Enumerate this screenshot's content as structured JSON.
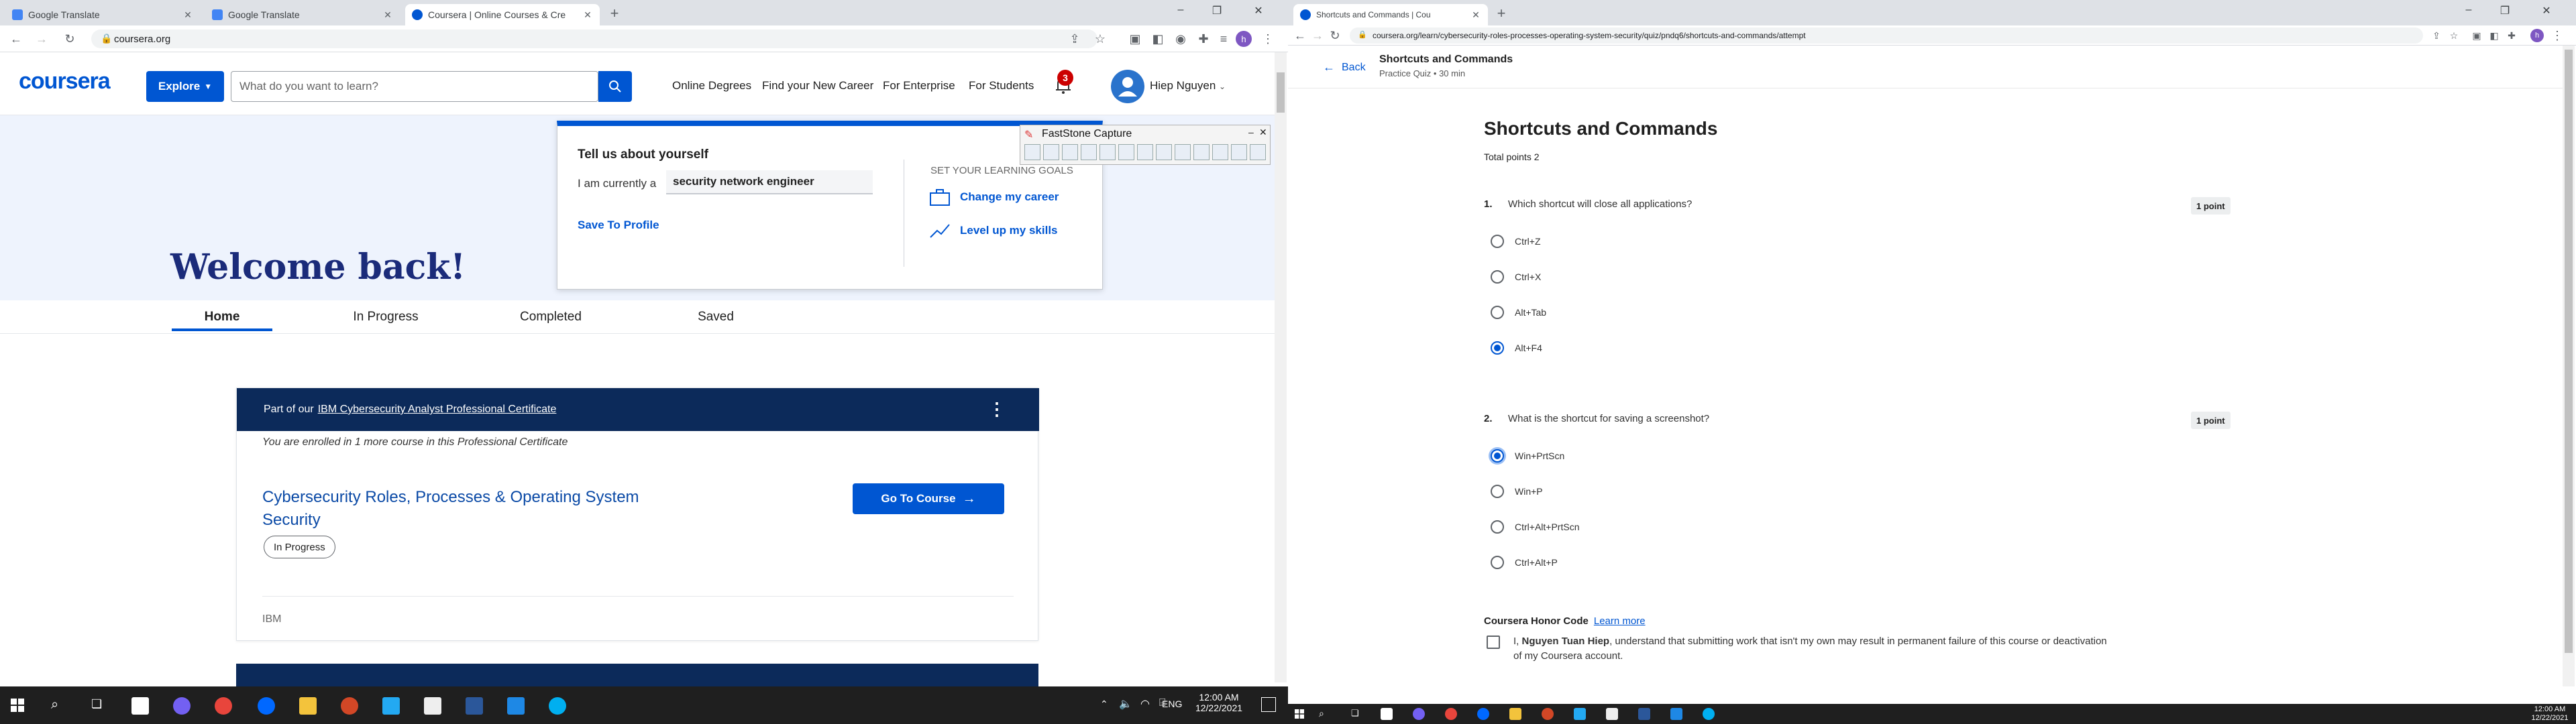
{
  "left": {
    "tabs": [
      {
        "title": "Google Translate",
        "active": false
      },
      {
        "title": "Google Translate",
        "active": false
      },
      {
        "title": "Coursera | Online Courses & Cre",
        "active": true
      }
    ],
    "url": "coursera.org",
    "profile_letter": "h",
    "header": {
      "logo": "coursera",
      "explore": "Explore",
      "search_placeholder": "What do you want to learn?",
      "links": [
        "Online Degrees",
        "Find your New Career",
        "For Enterprise",
        "For Students"
      ],
      "notif_count": "3",
      "user_name": "Hiep Nguyen"
    },
    "popup": {
      "heading": "Tell us about yourself",
      "currently_label": "I am currently a",
      "currently_value": "security network engineer",
      "save_link": "Save To Profile",
      "goals_heading": "SET YOUR LEARNING GOALS",
      "goals": [
        "Change my career",
        "Level up my skills"
      ]
    },
    "faststone": {
      "title": "FastStone Capture"
    },
    "welcome": "Welcome back!",
    "subtabs": [
      "Home",
      "In Progress",
      "Completed",
      "Saved"
    ],
    "card": {
      "part_of": "Part of our",
      "cert_link": "IBM Cybersecurity Analyst Professional Certificate",
      "enrolled": "You are enrolled in 1 more course in this Professional Certificate",
      "course_title": "Cybersecurity Roles, Processes & Operating System Security",
      "status": "In Progress",
      "go_button": "Go To Course",
      "provider": "IBM"
    },
    "taskbar": {
      "lang": "ENG",
      "time": "12:00 AM",
      "date": "12/22/2021"
    }
  },
  "right": {
    "tab_title": "Shortcuts and Commands | Cou",
    "url": "coursera.org/learn/cybersecurity-roles-processes-operating-system-security/quiz/pndq6/shortcuts-and-commands/attempt",
    "profile_letter": "h",
    "header": {
      "back": "Back",
      "title": "Shortcuts and Commands",
      "subtitle": "Practice Quiz • 30 min"
    },
    "quiz": {
      "title": "Shortcuts and Commands",
      "total_points": "Total points 2",
      "questions": [
        {
          "num": "1.",
          "text": "Which shortcut will close all applications?",
          "points": "1 point",
          "options": [
            "Ctrl+Z",
            "Ctrl+X",
            "Alt+Tab",
            "Alt+F4"
          ],
          "selected": 3
        },
        {
          "num": "2.",
          "text": "What is the shortcut for saving a screenshot?",
          "points": "1 point",
          "options": [
            "Win+PrtScn",
            "Win+P",
            "Ctrl+Alt+PrtScn",
            "Ctrl+Alt+P"
          ],
          "selected": 0
        }
      ],
      "honor_title": "Coursera Honor Code",
      "honor_link": "Learn more",
      "honor_prefix": "I,",
      "honor_name": "Nguyen Tuan Hiep",
      "honor_text": ", understand that submitting work that isn't my own may result in permanent failure of this course or deactivation of my Coursera account."
    },
    "taskbar": {
      "time": "12:00 AM",
      "date": "12/22/2021"
    }
  }
}
